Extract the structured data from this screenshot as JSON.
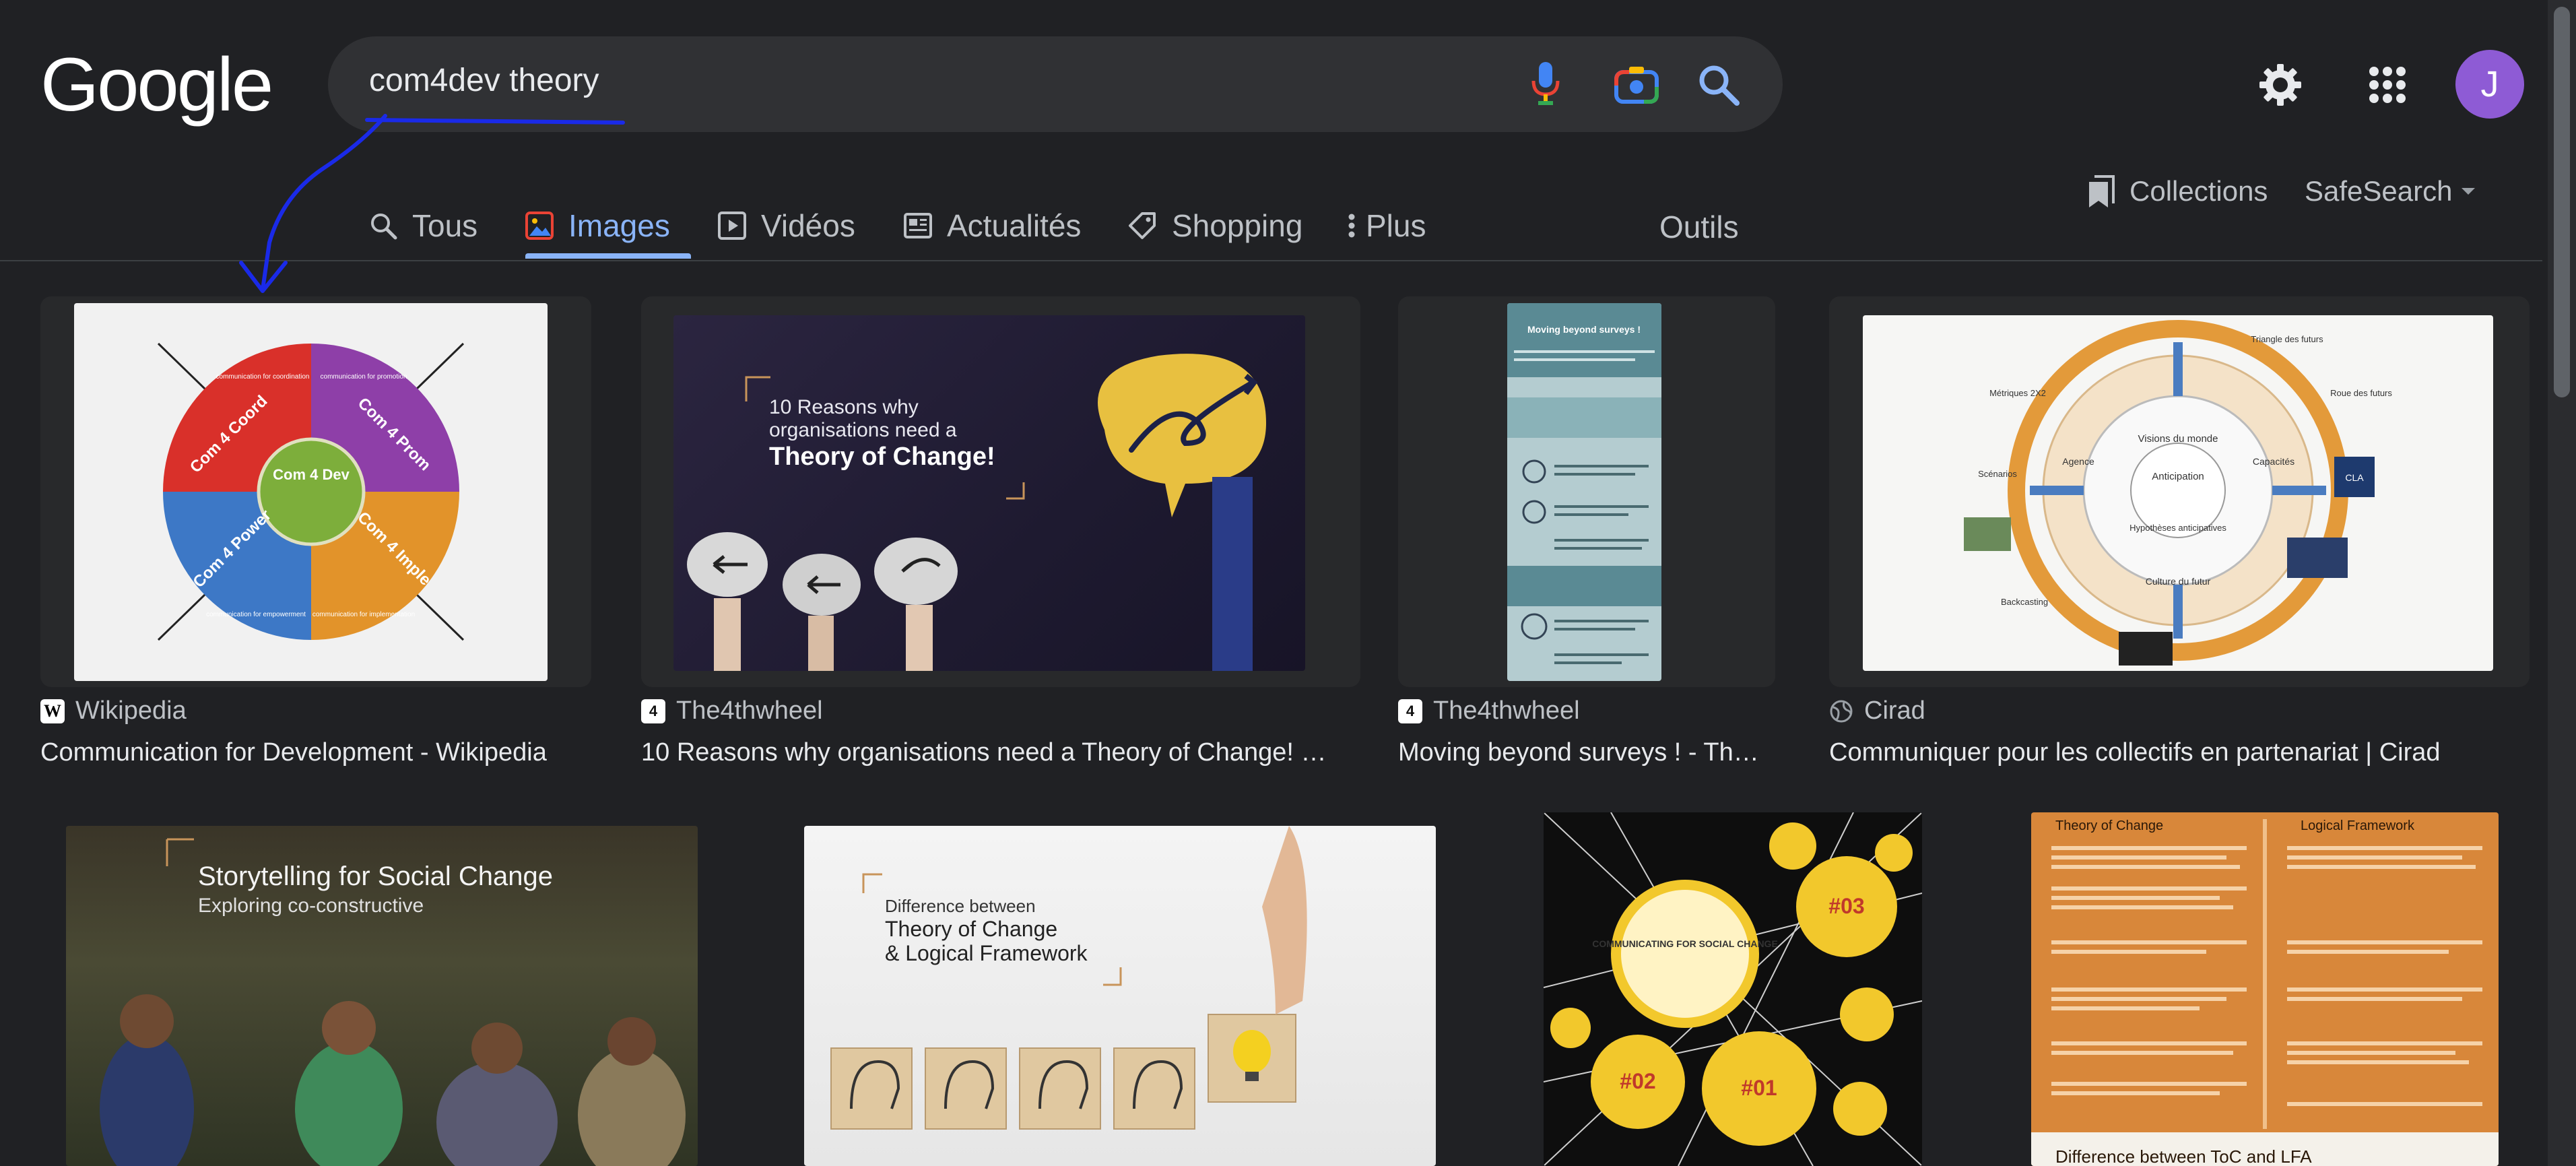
{
  "header": {
    "logo": "Google",
    "search_value": "com4dev theory",
    "avatar_letter": "J"
  },
  "tabs": [
    {
      "label": "Tous",
      "icon": "search-icon"
    },
    {
      "label": "Images",
      "icon": "image-icon",
      "active": true
    },
    {
      "label": "Vidéos",
      "icon": "play-icon"
    },
    {
      "label": "Actualités",
      "icon": "news-icon"
    },
    {
      "label": "Shopping",
      "icon": "tag-icon"
    },
    {
      "label": "Plus",
      "icon": "more-vert-icon"
    }
  ],
  "tools_label": "Outils",
  "collections_label": "Collections",
  "safesearch_label": "SafeSearch",
  "results": [
    {
      "source": "Wikipedia",
      "title": "Communication for Development - Wikipedia",
      "thumb": {
        "segments": [
          "Com 4 Coord",
          "Com 4 Prom",
          "Com 4 Power",
          "Com 4 Imple"
        ],
        "center": "Com 4 Dev",
        "captions": [
          "communication for coordination",
          "communication for promotion",
          "communication for empowerment",
          "communication for implementation"
        ]
      }
    },
    {
      "source": "The4thwheel",
      "title": "10 Reasons why organisations need a Theory of Change! - ...",
      "thumb": {
        "line1": "10 Reasons why",
        "line2": "organisations need a",
        "line3": "Theory of Change!"
      }
    },
    {
      "source": "The4thwheel",
      "title": "Moving beyond surveys ! - The...",
      "thumb": {
        "heading": "Moving beyond surveys !"
      }
    },
    {
      "source": "Cirad",
      "title": "Communiquer pour les collectifs en partenariat | Cirad",
      "thumb": {
        "labels": [
          "Visions du monde",
          "Anticipation",
          "Hypothèses anticipatives",
          "Culture du futur",
          "Capacités",
          "Agence",
          "Métriques 2X2",
          "Triangle des futurs",
          "Roue des futurs",
          "Scénarios",
          "Backcasting",
          "CLA"
        ]
      }
    }
  ],
  "results_row2": [
    {
      "thumb": {
        "title": "Storytelling for Social Change",
        "subtitle": "Exploring co-constructive"
      }
    },
    {
      "thumb": {
        "line1": "Difference between",
        "line2": "Theory of Change",
        "line3": "& Logical Framework"
      }
    },
    {
      "thumb": {
        "heading": "COMMUNICATING FOR SOCIAL CHANGE",
        "badges": [
          "#01",
          "#02",
          "#03"
        ]
      }
    },
    {
      "thumb": {
        "col1": "Theory of Change",
        "col2": "Logical Framework",
        "footer": "Difference between ToC and LFA"
      }
    }
  ],
  "colors": {
    "accent": "#8ab4f8",
    "background": "#202124",
    "search": "#303134",
    "annotation": "#1a2ae8"
  }
}
